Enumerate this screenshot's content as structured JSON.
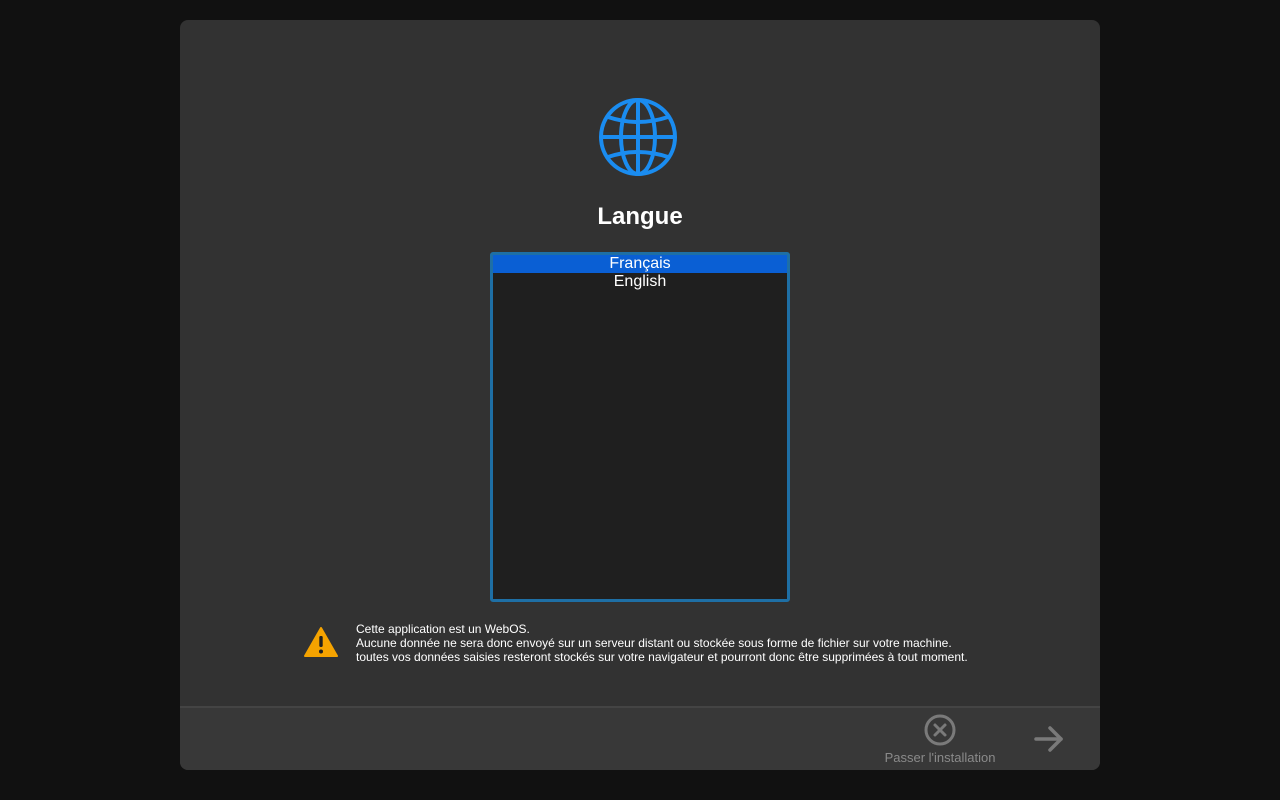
{
  "setup": {
    "title": "Langue",
    "globe_icon": "globe-icon",
    "languages": [
      {
        "label": "Français",
        "selected": true
      },
      {
        "label": "English",
        "selected": false
      }
    ]
  },
  "warning": {
    "icon": "warning-icon",
    "line1": "Cette application est un WebOS.",
    "line2": "Aucune donnée ne sera donc envoyé sur un serveur distant ou stockée sous forme de fichier sur votre machine.",
    "line3": "toutes vos données saisies resteront stockés sur votre navigateur et pourront donc être supprimées à tout moment."
  },
  "footer": {
    "skip_label": "Passer l'installation",
    "skip_icon": "close-circle-icon",
    "next_icon": "arrow-right-icon"
  },
  "colors": {
    "accent": "#1a8cf0",
    "selection": "#0a5fd4",
    "listbox_border": "#1e6fa5",
    "warning": "#f5a300"
  }
}
